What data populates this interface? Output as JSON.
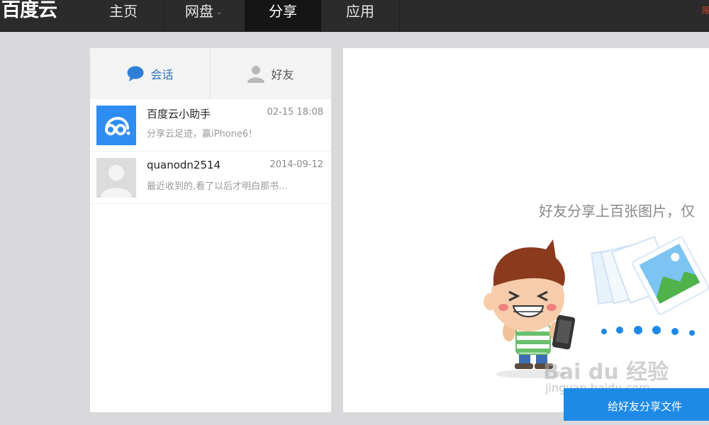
{
  "topbar": {
    "logo": "百度云",
    "nav": [
      {
        "label": "主页"
      },
      {
        "label": "网盘"
      },
      {
        "label": "分享"
      },
      {
        "label": "应用"
      }
    ],
    "chevron": "⌄",
    "corner_text": "限"
  },
  "sidebar": {
    "tabs": [
      {
        "label": "会话",
        "icon": "chat-bubble-icon",
        "active": true
      },
      {
        "label": "好友",
        "icon": "user-icon",
        "active": false
      }
    ],
    "conversations": [
      {
        "name": "百度云小助手",
        "time": "02-15 18:08",
        "preview": "分享云足迹，赢iPhone6！",
        "avatar": "baidu-cloud-icon"
      },
      {
        "name": "quanodn2514",
        "time": "2014-09-12",
        "preview": "最近收到的,看了以后才明白那书...",
        "avatar": "default-user-avatar"
      }
    ]
  },
  "main": {
    "headline": "好友分享上百张图片，仅",
    "cta_label": "给好友分享文件",
    "illustration": "cartoon-boy-with-phone-and-photos"
  },
  "watermark": {
    "brand": "Bai du 经验",
    "url": "jingyan.baidu.com"
  },
  "colors": {
    "topbar": "#2b2b2b",
    "accent": "#1e8ae6",
    "background": "#d9d9db"
  }
}
